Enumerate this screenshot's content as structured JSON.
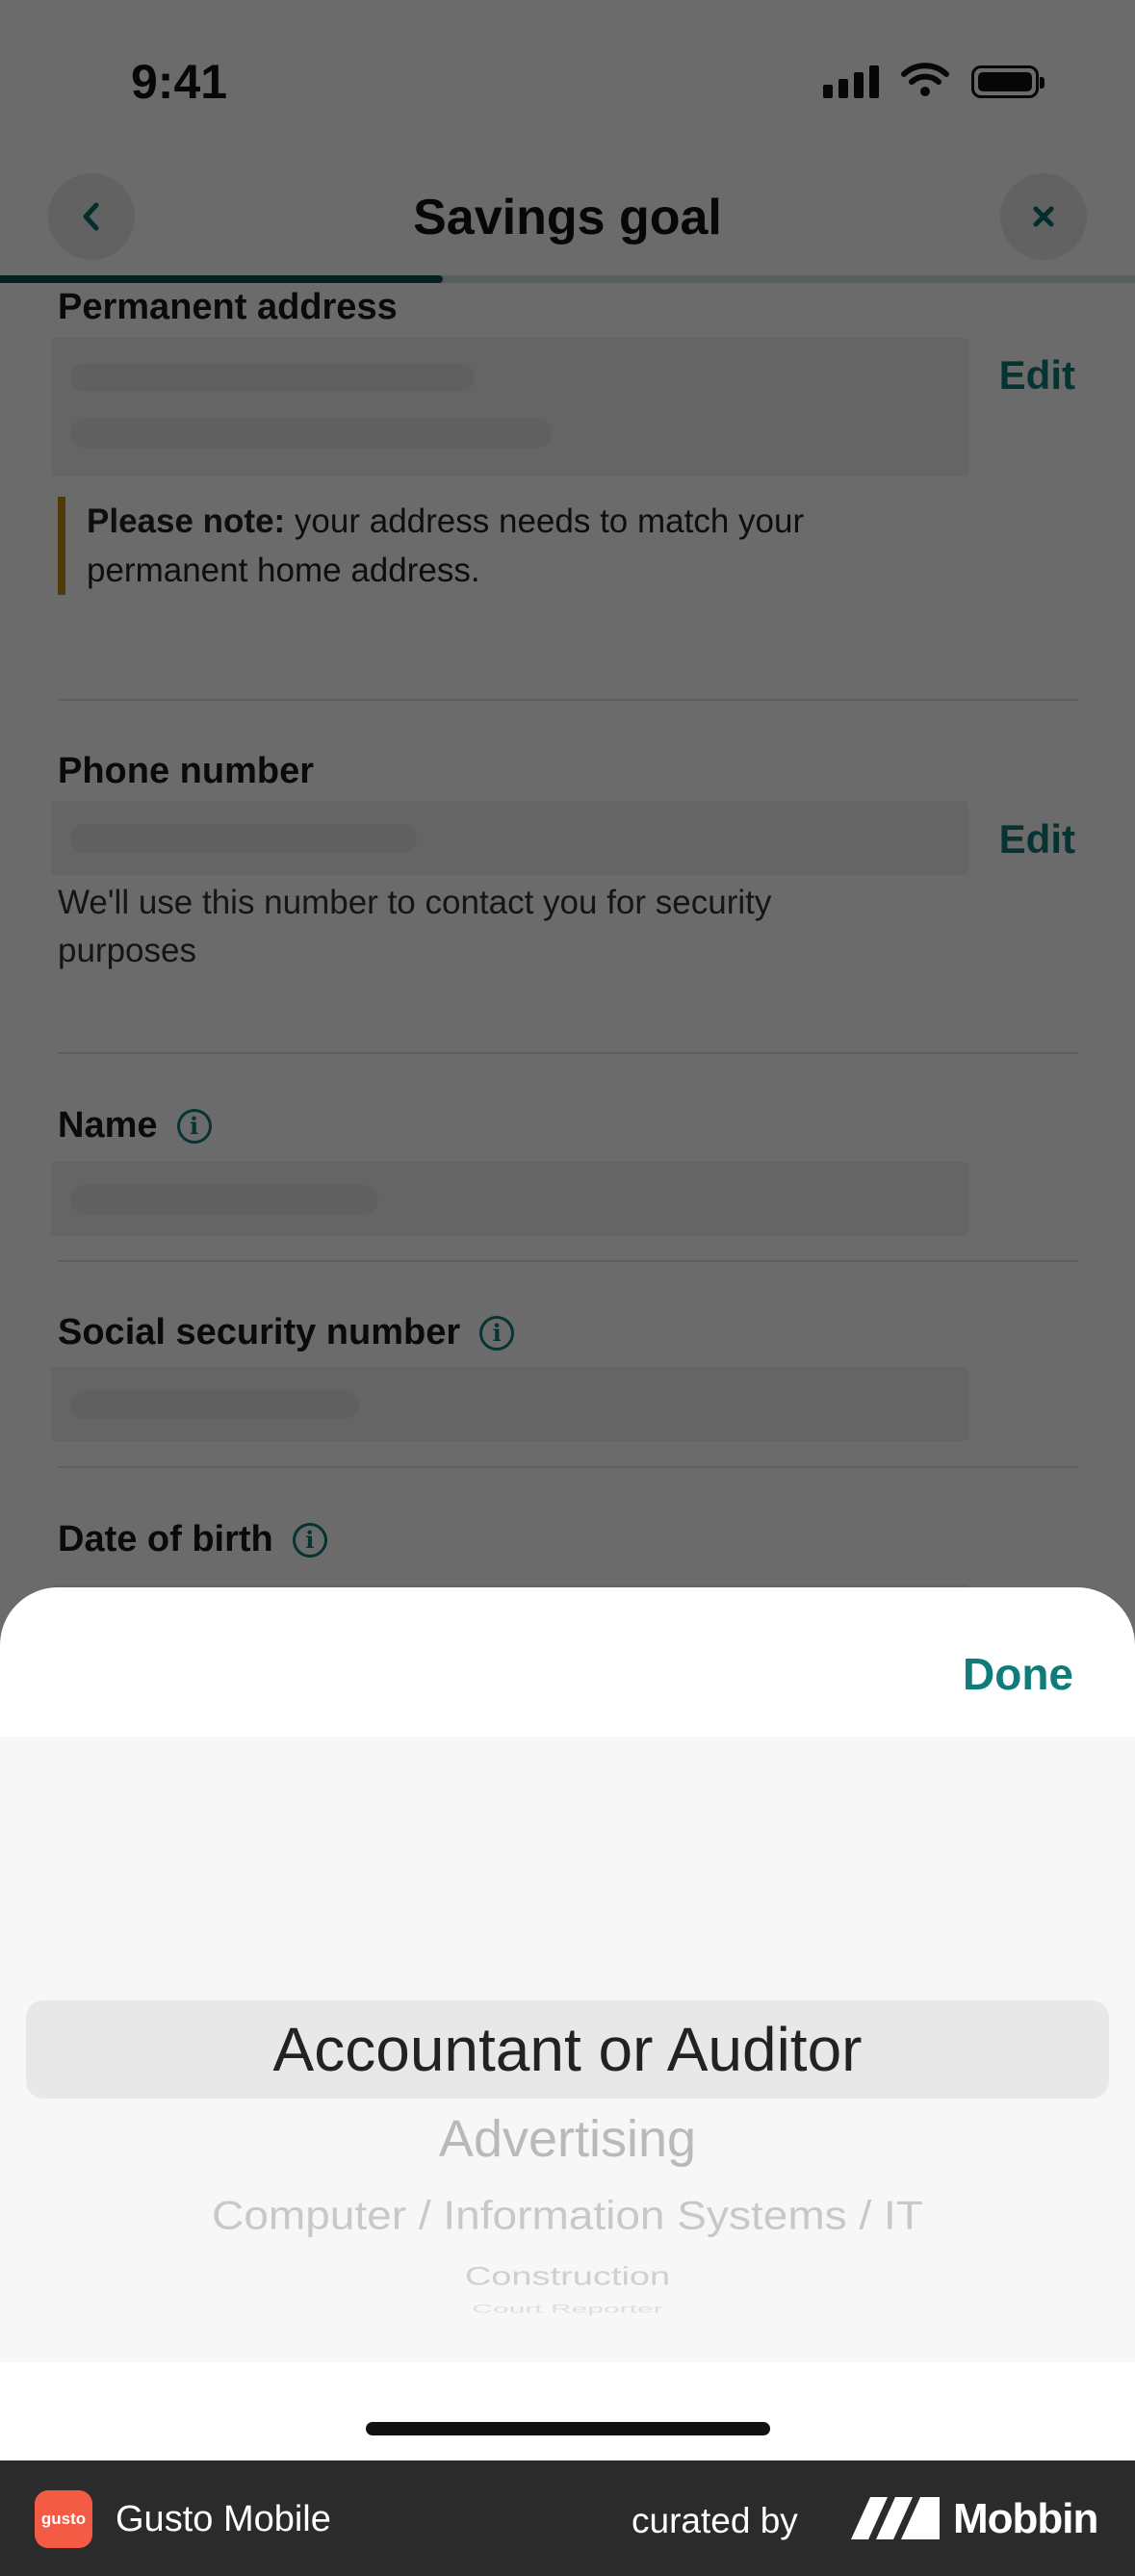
{
  "status_bar": {
    "time": "9:41"
  },
  "header": {
    "title": "Savings goal",
    "back_icon": "chevron-left-icon",
    "close_icon": "close-icon",
    "progress_fraction": 0.39
  },
  "form": {
    "permanent_address": {
      "label": "Permanent address",
      "edit_label": "Edit",
      "note_bold": "Please note:",
      "note_text": " your address needs to match your permanent home address."
    },
    "phone_number": {
      "label": "Phone number",
      "edit_label": "Edit",
      "helper": "We'll use this number to contact you for security purposes"
    },
    "name": {
      "label": "Name"
    },
    "ssn": {
      "label": "Social security number"
    },
    "dob": {
      "label": "Date of birth"
    }
  },
  "sheet": {
    "done_label": "Done",
    "options": [
      "Accountant or Auditor",
      "Advertising",
      "Computer / Information Systems / IT",
      "Construction",
      "Court Reporter"
    ],
    "selected_index": 0
  },
  "footer": {
    "app_logo_text": "gusto",
    "app_name": "Gusto Mobile",
    "curated_by": "curated by",
    "brand": "Mobbin"
  },
  "colors": {
    "accent": "#0e7c79",
    "progress": "#0b4e4c",
    "note_border": "#b98a17",
    "app_logo_bg": "#f35b45"
  }
}
